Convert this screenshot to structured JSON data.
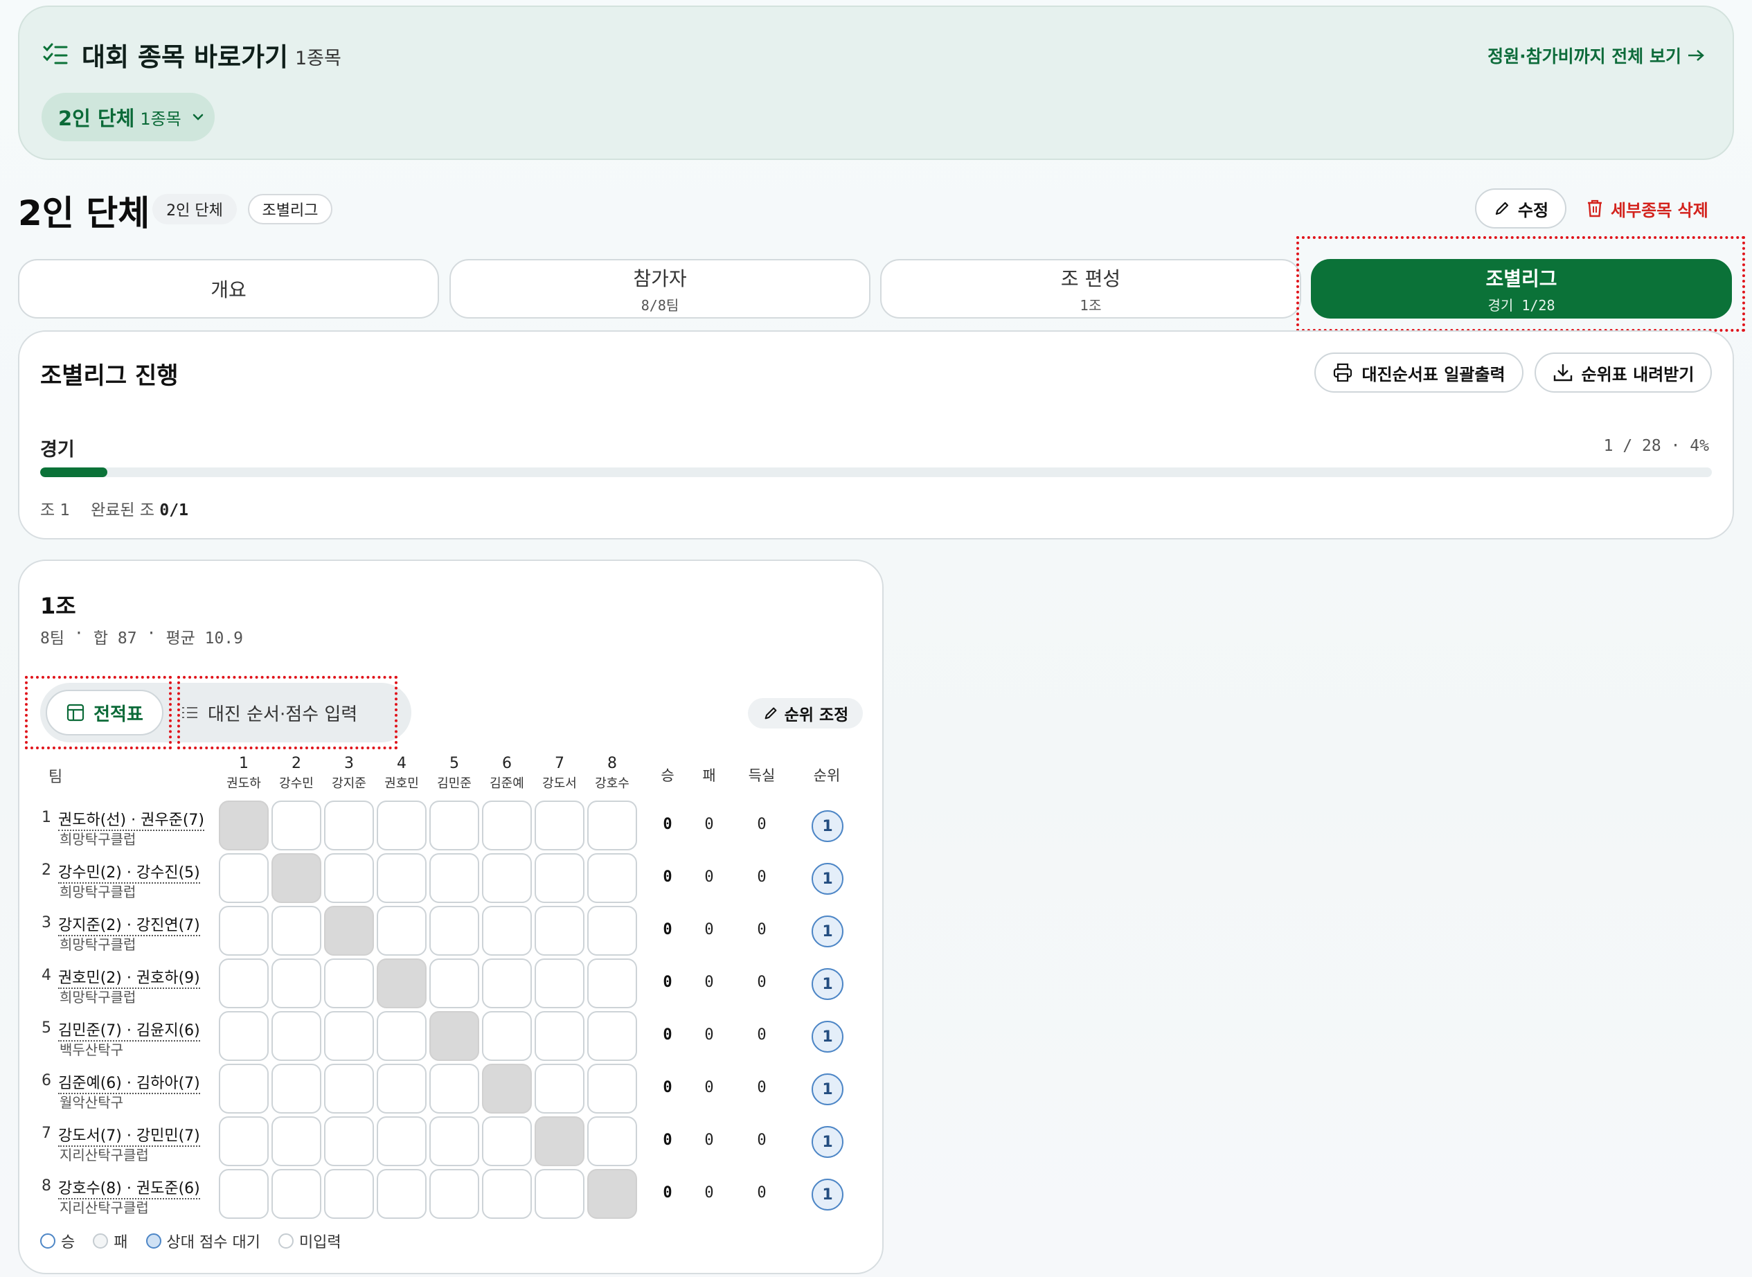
{
  "shortcut": {
    "title": "대회 종목 바로가기",
    "count": "1종목",
    "view_all": "정원·참가비까지 전체 보기",
    "chip_label": "2인 단체",
    "chip_sub": "1종목"
  },
  "header": {
    "title": "2인 단체",
    "tags": [
      "2인 단체",
      "조별리그"
    ],
    "edit_label": "수정",
    "delete_label": "세부종목 삭제"
  },
  "tabs": [
    {
      "label": "개요",
      "sub": ""
    },
    {
      "label": "참가자",
      "sub": "8/8팀"
    },
    {
      "label": "조 편성",
      "sub": "1조"
    },
    {
      "label": "조별리그",
      "sub": "경기 1/28",
      "active": true
    }
  ],
  "progress": {
    "title": "조별리그 진행",
    "print_label": "대진순서표 일괄출력",
    "download_label": "순위표 내려받기",
    "label": "경기",
    "count": "1 / 28 · 4%",
    "fraction": 0.04,
    "groups": "조 1",
    "completed_prefix": "완료된 조",
    "completed_value": "0/1"
  },
  "group": {
    "title": "1조",
    "meta": [
      "8팀",
      "·",
      "합 87",
      "·",
      "평균 10.9"
    ],
    "view_table": "전적표",
    "view_order": "대진 순서·점수 입력",
    "rank_adjust": "순위 조정",
    "team_header": "팀",
    "columns": [
      {
        "n": "1",
        "name": "권도하"
      },
      {
        "n": "2",
        "name": "강수민"
      },
      {
        "n": "3",
        "name": "강지준"
      },
      {
        "n": "4",
        "name": "권호민"
      },
      {
        "n": "5",
        "name": "김민준"
      },
      {
        "n": "6",
        "name": "김준예"
      },
      {
        "n": "7",
        "name": "강도서"
      },
      {
        "n": "8",
        "name": "강호수"
      }
    ],
    "stat_headers": [
      "승",
      "패",
      "득실",
      "순위"
    ],
    "rows": [
      {
        "idx": "1",
        "name": "권도하(선) · 권우준(7)",
        "club": "희망탁구클럽",
        "w": "0",
        "l": "0",
        "d": "0",
        "rank": "1"
      },
      {
        "idx": "2",
        "name": "강수민(2) · 강수진(5)",
        "club": "희망탁구클럽",
        "w": "0",
        "l": "0",
        "d": "0",
        "rank": "1"
      },
      {
        "idx": "3",
        "name": "강지준(2) · 강진연(7)",
        "club": "희망탁구클럽",
        "w": "0",
        "l": "0",
        "d": "0",
        "rank": "1"
      },
      {
        "idx": "4",
        "name": "권호민(2) · 권호하(9)",
        "club": "희망탁구클럽",
        "w": "0",
        "l": "0",
        "d": "0",
        "rank": "1"
      },
      {
        "idx": "5",
        "name": "김민준(7) · 김윤지(6)",
        "club": "백두산탁구",
        "w": "0",
        "l": "0",
        "d": "0",
        "rank": "1"
      },
      {
        "idx": "6",
        "name": "김준예(6) · 김하아(7)",
        "club": "월악산탁구",
        "w": "0",
        "l": "0",
        "d": "0",
        "rank": "1"
      },
      {
        "idx": "7",
        "name": "강도서(7) · 강민민(7)",
        "club": "지리산탁구클럽",
        "w": "0",
        "l": "0",
        "d": "0",
        "rank": "1"
      },
      {
        "idx": "8",
        "name": "강호수(8) · 권도준(6)",
        "club": "지리산탁구클럽",
        "w": "0",
        "l": "0",
        "d": "0",
        "rank": "1"
      }
    ],
    "legend": [
      "승",
      "패",
      "상대 점수 대기",
      "미입력"
    ]
  },
  "colors": {
    "accent": "#0b7238",
    "danger": "#d3231d",
    "rank_blue": "#4d86c6",
    "highlight": "#e0141b"
  }
}
